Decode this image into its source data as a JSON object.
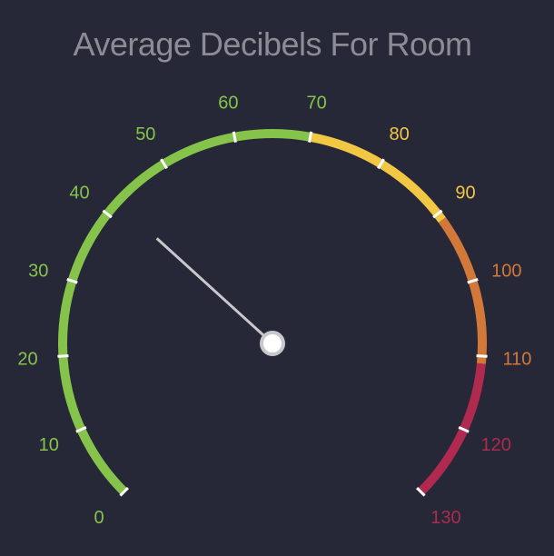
{
  "chart_data": {
    "type": "gauge",
    "title": "Average Decibels For Room",
    "min": 0,
    "max": 130,
    "tick_interval": 10,
    "tick_labels": [
      "0",
      "10",
      "20",
      "30",
      "40",
      "50",
      "60",
      "70",
      "80",
      "90",
      "100",
      "110",
      "120",
      "130"
    ],
    "value": 42,
    "bands": [
      {
        "from": 0,
        "to": 70,
        "color": "#86c34a"
      },
      {
        "from": 70,
        "to": 91,
        "color": "#f2c744"
      },
      {
        "from": 91,
        "to": 111,
        "color": "#d2793a"
      },
      {
        "from": 111,
        "to": 130,
        "color": "#b0294f"
      }
    ],
    "colors": {
      "background": "#262838",
      "needle": "#c8c8cc",
      "tick": "#ffffff"
    }
  }
}
